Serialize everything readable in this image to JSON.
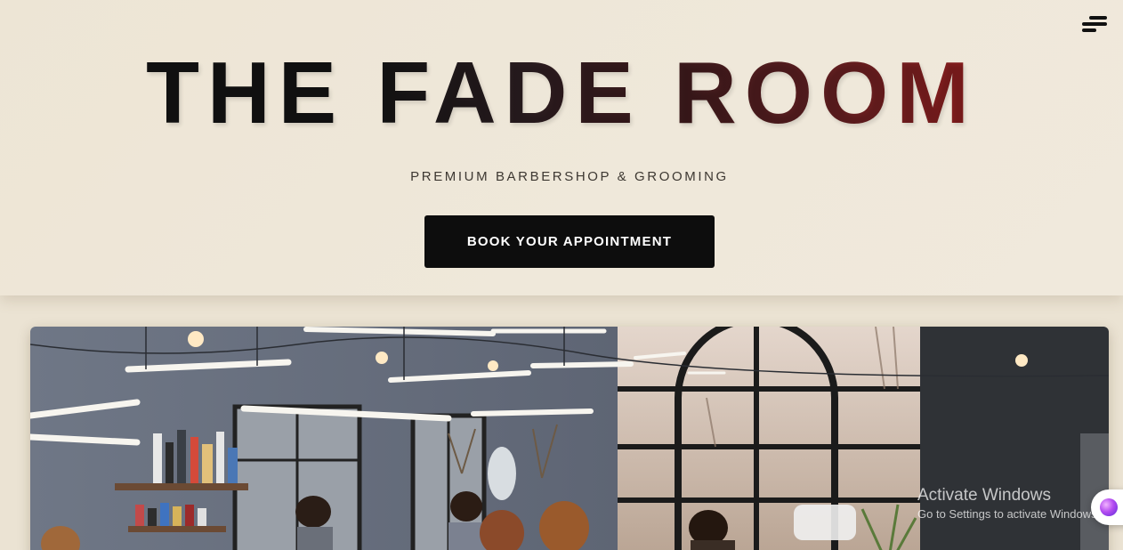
{
  "header": {
    "menu_icon": "hamburger-menu-icon"
  },
  "hero": {
    "title_word_1": "THE",
    "title_word_2": "FADE",
    "title_word_3": "ROOM",
    "tagline": "PREMIUM BARBERSHOP & GROOMING",
    "cta_label": "BOOK YOUR APPOINTMENT"
  },
  "colors": {
    "title_dark": "#101010",
    "title_red": "#8a1e1e",
    "cta_bg": "#0d0d0d",
    "page_bg": "#ebe3d3"
  },
  "overlay": {
    "watermark_title": "Activate Windows",
    "watermark_sub": "Go to Settings to activate Windows.",
    "chat_icon": "assistant-chat-icon"
  }
}
